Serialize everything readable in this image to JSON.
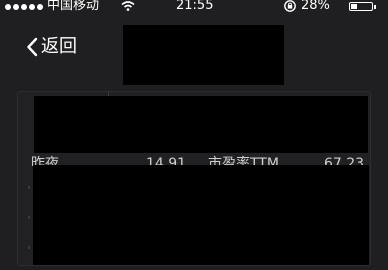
{
  "status_bar": {
    "carrier": "中国移动",
    "time": "21:55",
    "battery_percent": "28%",
    "battery_level": 0.28,
    "wifi_icon": "wifi-icon",
    "lock_icon": "rotation-lock-icon"
  },
  "nav": {
    "back_label": "返回",
    "back_icon": "chevron-left-icon"
  },
  "stats": {
    "label_1": "昨夜",
    "value_1": "14.91",
    "label_2": "市盈率TTM",
    "value_2": "67.23"
  },
  "colors": {
    "background": "#1f1f21",
    "panel": "#212123",
    "text": "#ffffff",
    "muted_text": "#cfcfcf",
    "redaction": "#000000"
  }
}
